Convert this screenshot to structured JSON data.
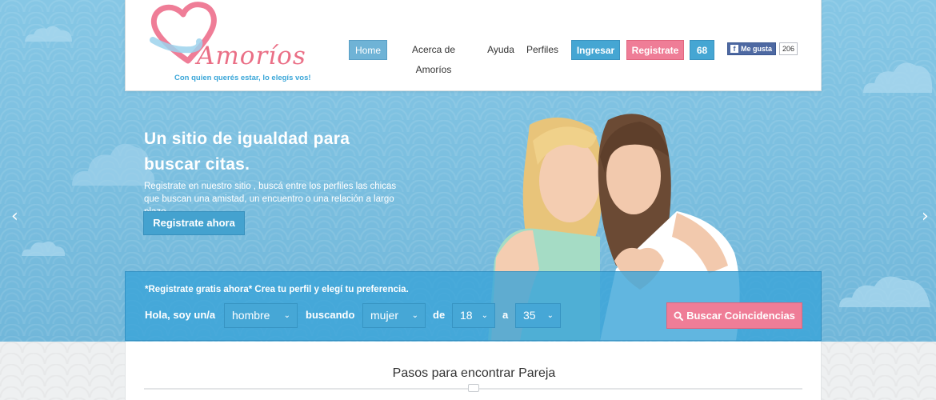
{
  "header": {
    "logo_text": "Amoríos",
    "tagline": "Con quien querés estar, lo elegís vos!",
    "nav": {
      "home": "Home",
      "about": "Acerca de Amoríos",
      "help": "Ayuda",
      "profiles": "Perfiles",
      "login": "Ingresar",
      "register": "Registrate",
      "count": "68"
    },
    "facebook": {
      "label": "Me gusta",
      "count": "206"
    }
  },
  "hero": {
    "title": "Un sitio de igualdad para buscar citas.",
    "text": "Registrate en nuestro sitio , buscá entre los perfiles las chicas que buscan una amistad, un encuentro o una relación a largo plazo.",
    "cta": "Registrate ahora",
    "prev_icon": "chevron-left-icon",
    "next_icon": "chevron-right-icon"
  },
  "search": {
    "note": "*Registrate gratis ahora* Crea tu perfil y elegí tu preferencia.",
    "label_iam": "Hola, soy un/a",
    "iam_value": "hombre",
    "label_seeking": "buscando",
    "seeking_value": "mujer",
    "label_from": "de",
    "age_min": "18",
    "label_to": "a",
    "age_max": "35",
    "button": "Buscar Coincidencias"
  },
  "section": {
    "title": "Pasos para encontrar Pareja"
  },
  "colors": {
    "sky": "#7cc0e0",
    "accent_blue": "#45a6d3",
    "accent_pink": "#ef7d97"
  }
}
